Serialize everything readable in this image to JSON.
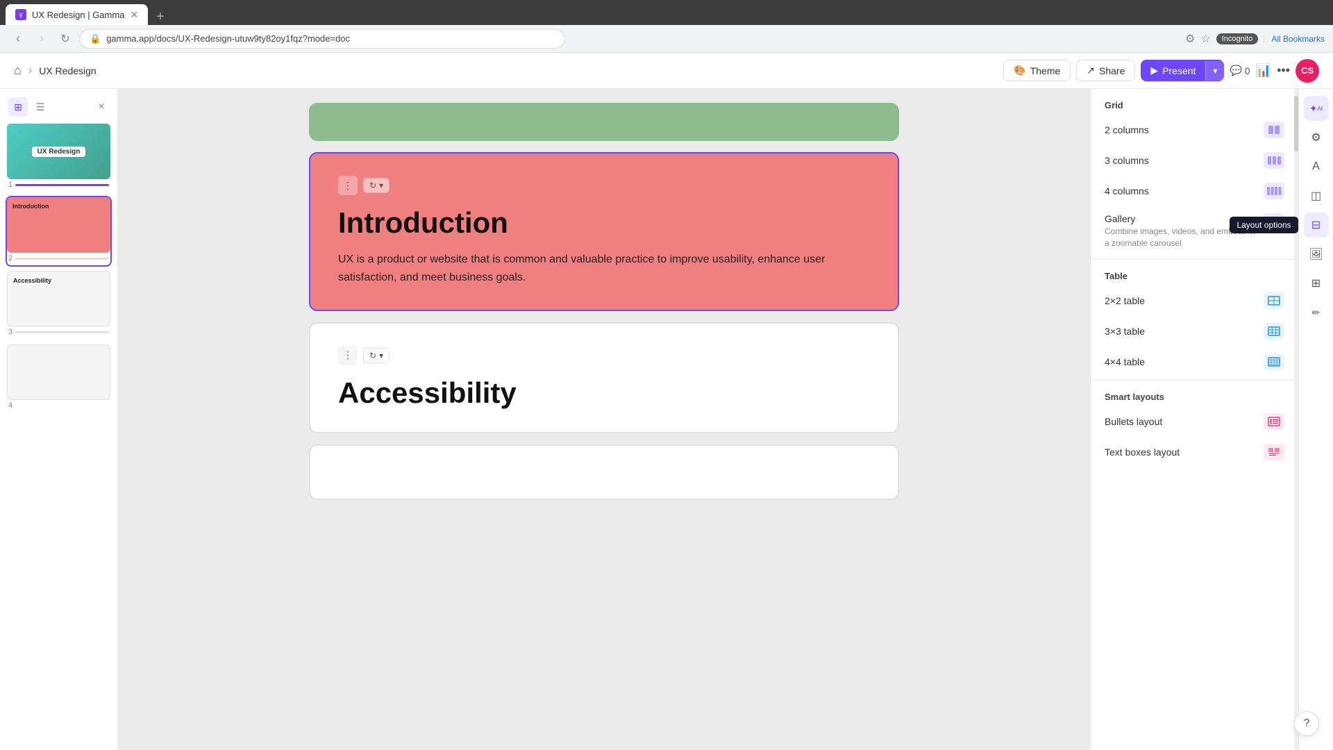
{
  "browser": {
    "tab_title": "UX Redesign | Gamma",
    "url": "gamma.app/docs/UX-Redesign-utuw9ty82oy1fqz?mode=doc",
    "incognito_text": "Incognito",
    "all_bookmarks": "All Bookmarks"
  },
  "topbar": {
    "home_icon": "⌂",
    "breadcrumb_sep": "›",
    "breadcrumb_item": "UX Redesign",
    "theme_label": "Theme",
    "share_label": "Share",
    "present_label": "Present",
    "comments_count": "0",
    "avatar_initials": "CS"
  },
  "sidebar": {
    "close_icon": "×",
    "slides": [
      {
        "num": "1",
        "label": "UX Redesign",
        "type": "gradient"
      },
      {
        "num": "2",
        "label": "Introduction",
        "type": "pink"
      },
      {
        "num": "3",
        "label": "Accessibility",
        "type": "white"
      },
      {
        "num": "4",
        "label": "",
        "type": "empty"
      }
    ]
  },
  "slides": [
    {
      "id": "intro",
      "title": "Introduction",
      "body": "UX is a product or website that is common and valuable practice to improve usability, enhance user satisfaction, and meet business goals."
    },
    {
      "id": "access",
      "title": "Accessibility",
      "body": ""
    }
  ],
  "layout_panel": {
    "grid_header": "Grid",
    "grid_items": [
      {
        "label": "2 columns"
      },
      {
        "label": "3 columns"
      },
      {
        "label": "4 columns"
      }
    ],
    "gallery_label": "Gallery",
    "gallery_sub": "Combine images, videos, and embeds in a zoomable carousel",
    "table_header": "Table",
    "table_items": [
      {
        "label": "2×2 table"
      },
      {
        "label": "3×3 table"
      },
      {
        "label": "4×4 table"
      }
    ],
    "smart_header": "Smart layouts",
    "smart_items": [
      {
        "label": "Bullets layout"
      },
      {
        "label": "Text boxes layout"
      }
    ],
    "tooltip_text": "Layout options"
  },
  "help_label": "?"
}
